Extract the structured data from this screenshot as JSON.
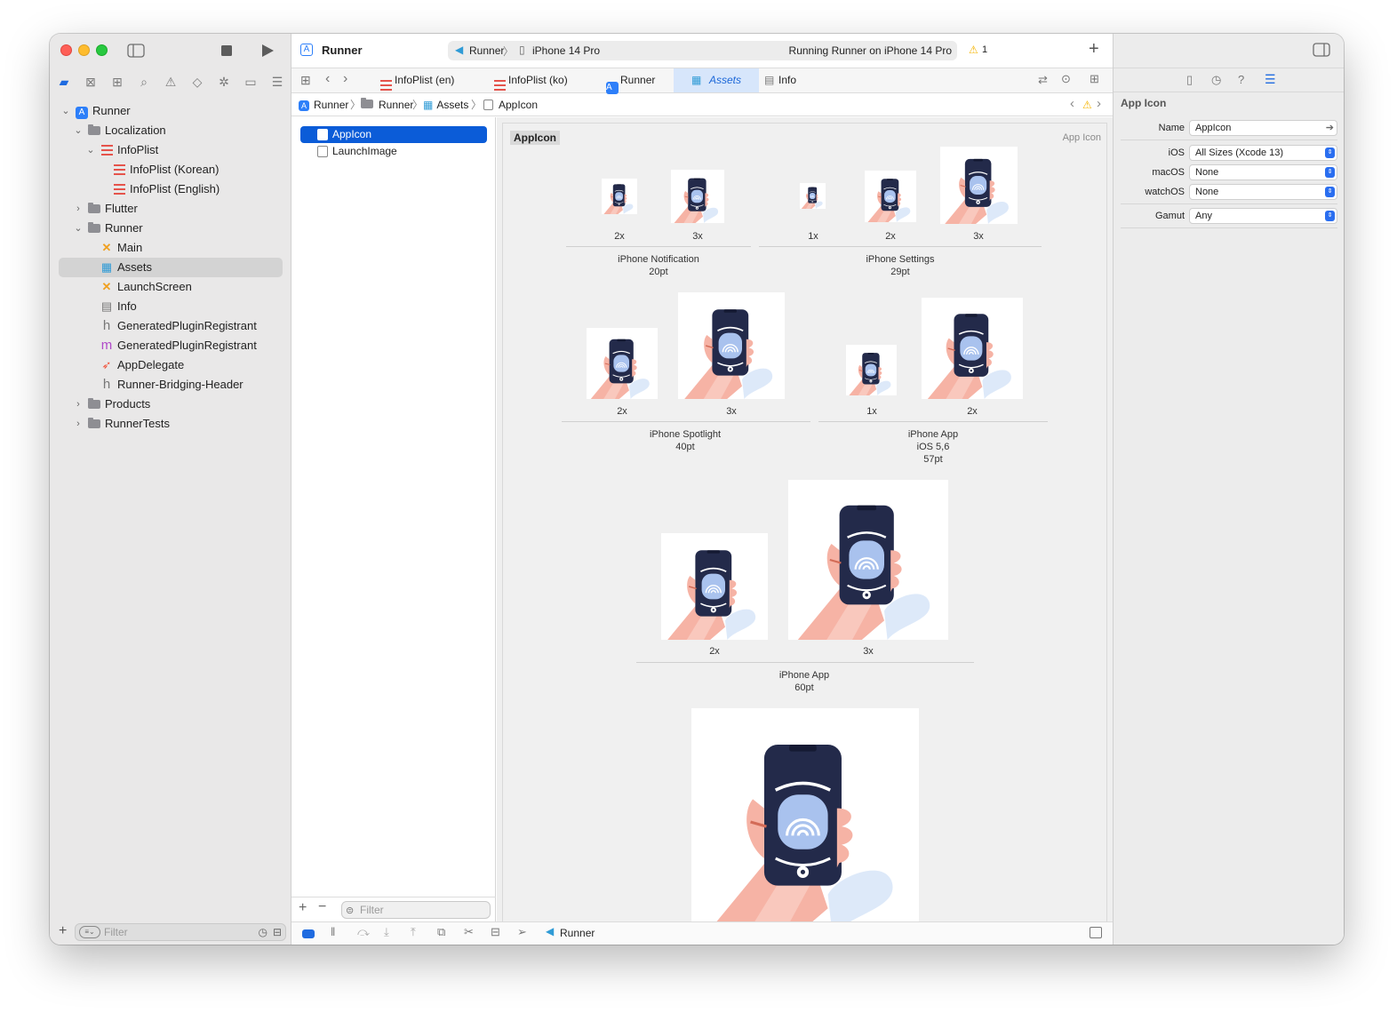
{
  "toolbar": {
    "title": "Runner",
    "scheme": "Runner",
    "device": "iPhone 14 Pro",
    "status": "Running Runner on iPhone 14 Pro",
    "warning_count": "1"
  },
  "navigator": {
    "tree": [
      {
        "label": "Runner"
      },
      {
        "label": "Localization"
      },
      {
        "label": "InfoPlist"
      },
      {
        "label": "InfoPlist (Korean)"
      },
      {
        "label": "InfoPlist (English)"
      },
      {
        "label": "Flutter"
      },
      {
        "label": "Runner"
      },
      {
        "label": "Main"
      },
      {
        "label": "Assets"
      },
      {
        "label": "LaunchScreen"
      },
      {
        "label": "Info"
      },
      {
        "label": "GeneratedPluginRegistrant"
      },
      {
        "label": "GeneratedPluginRegistrant"
      },
      {
        "label": "AppDelegate"
      },
      {
        "label": "Runner-Bridging-Header"
      },
      {
        "label": "Products"
      },
      {
        "label": "RunnerTests"
      }
    ],
    "filter_placeholder": "Filter"
  },
  "tabs": [
    "InfoPlist (en)",
    "InfoPlist (ko)",
    "Runner",
    "Assets",
    "Info"
  ],
  "breadcrumb": [
    "Runner",
    "Runner",
    "Assets",
    "AppIcon"
  ],
  "assets": {
    "items": [
      "AppIcon",
      "LaunchImage"
    ],
    "filter_placeholder": "Filter"
  },
  "canvas": {
    "set_name": "AppIcon",
    "set_kind": "App Icon",
    "groups": [
      {
        "name": "iPhone Notification",
        "size": "20pt",
        "scales": [
          "2x",
          "3x"
        ]
      },
      {
        "name": "iPhone Settings",
        "size": "29pt",
        "scales": [
          "1x",
          "2x",
          "3x"
        ]
      },
      {
        "name": "iPhone Spotlight",
        "size": "40pt",
        "scales": [
          "2x",
          "3x"
        ]
      },
      {
        "name": "iPhone App",
        "subtitle": "iOS 5,6",
        "size": "57pt",
        "scales": [
          "1x",
          "2x"
        ]
      },
      {
        "name": "iPhone App",
        "size": "60pt",
        "scales": [
          "2x",
          "3x"
        ]
      }
    ]
  },
  "debug_bar": {
    "target": "Runner"
  },
  "inspector": {
    "title": "App Icon",
    "fields": [
      {
        "label": "Name",
        "value": "AppIcon"
      },
      {
        "label": "iOS",
        "value": "All Sizes (Xcode 13)"
      },
      {
        "label": "macOS",
        "value": "None"
      },
      {
        "label": "watchOS",
        "value": "None"
      },
      {
        "label": "Gamut",
        "value": "Any"
      }
    ]
  },
  "colors": {
    "accent": "#0b5cd8",
    "phone": "#232a4a",
    "screen": "#a9c2ee",
    "hand": "#f5a99a",
    "warning": "#f5b400"
  }
}
